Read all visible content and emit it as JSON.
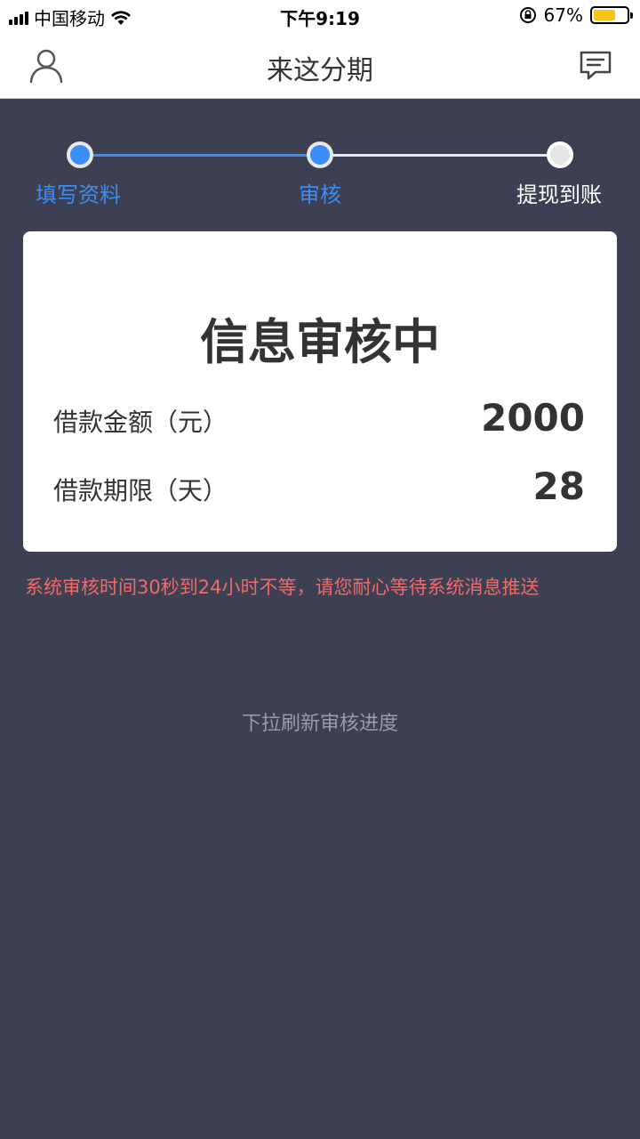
{
  "status_bar": {
    "carrier": "中国移动",
    "time": "下午9:19",
    "battery_percent": "67%",
    "battery_level": 0.66,
    "icons": [
      "signal-icon",
      "wifi-icon",
      "rotation-lock-icon",
      "battery-icon"
    ]
  },
  "nav": {
    "title": "来这分期",
    "left_icon": "profile-icon",
    "right_icon": "message-icon"
  },
  "steps": {
    "items": [
      {
        "label": "填写资料",
        "state": "done"
      },
      {
        "label": "审核",
        "state": "current"
      },
      {
        "label": "提现到账",
        "state": "pending"
      }
    ],
    "active_color": "#3a8ef6",
    "inactive_color": "#e8e8e8"
  },
  "card": {
    "heading": "信息审核中",
    "amount_label": "借款金额（元）",
    "amount_value": "2000",
    "term_label": "借款期限（天）",
    "term_value": "28"
  },
  "notice": "系统审核时间30秒到24小时不等，请您耐心等待系统消息推送",
  "pull_hint": "下拉刷新审核进度",
  "colors": {
    "background": "#3c4052",
    "notice": "#ef6b6b"
  }
}
